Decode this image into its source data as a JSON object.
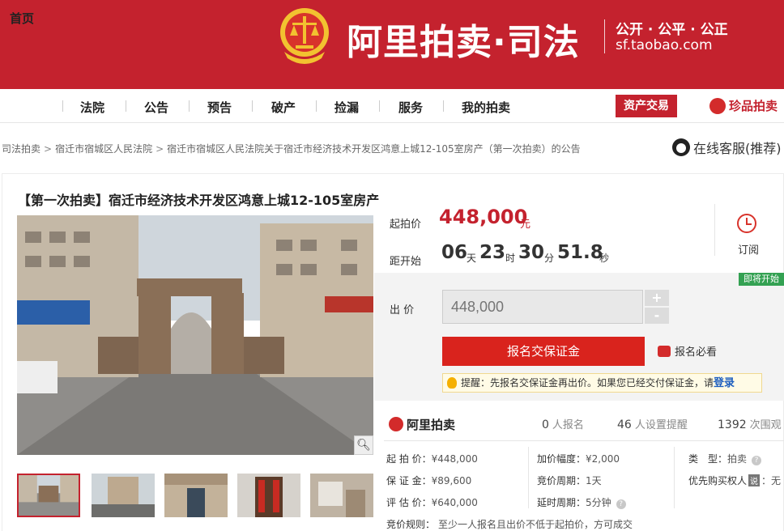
{
  "header": {
    "brand_title": "阿里拍卖·司法",
    "slogan": "公开 · 公平 · 公正",
    "url": "sf.taobao.com"
  },
  "nav": {
    "items": [
      "首页",
      "法院",
      "公告",
      "预告",
      "破产",
      "捡漏",
      "服务",
      "我的拍卖"
    ],
    "assets": "资产交易",
    "zhenpin": "珍品拍卖"
  },
  "breadcrumb": [
    "司法拍卖",
    "宿迁市宿城区人民法院",
    "宿迁市宿城区人民法院关于宿迁市经济技术开发区鸿意上城12-105室房产（第一次拍卖）的公告"
  ],
  "service": "在线客服(推荐)",
  "item": {
    "title": "【第一次拍卖】宿迁市经济技术开发区鸿意上城12-105室房产",
    "start_price_label": "起拍价",
    "start_price": "448,000",
    "currency": "元",
    "countdown_label": "距开始",
    "countdown": {
      "days": "06",
      "days_unit": "天",
      "hours": "23",
      "hours_unit": "时",
      "minutes": "30",
      "minutes_unit": "分",
      "seconds": "51.8",
      "seconds_unit": "秒"
    },
    "subscribe": "订阅",
    "status_badge": "即将开始",
    "bid_label": "出 价",
    "bid_placeholder": "448,000",
    "plus": "+",
    "minus": "-",
    "deposit_button": "报名交保证金",
    "must_see": "报名必看",
    "tip_prefix": "提醒：先报名交保证金再出价。如果您已经交付保证金，请",
    "tip_login": "登录",
    "zoom_icon": "magnifier-icon"
  },
  "stats": {
    "brand": "阿里拍卖",
    "signups": "0",
    "signups_label": "人报名",
    "reminders": "46",
    "reminders_label": "人设置提醒",
    "views": "1392",
    "views_label": "次围观"
  },
  "info": {
    "start_price": {
      "k": "起 拍 价：",
      "v": "¥448,000"
    },
    "deposit": {
      "k": "保 证 金：",
      "v": "¥89,600"
    },
    "appraisal": {
      "k": "评 估 价：",
      "v": "¥640,000"
    },
    "increment": {
      "k": "加价幅度：",
      "v": "¥2,000"
    },
    "period": {
      "k": "竞价周期：",
      "v": "1天"
    },
    "extension": {
      "k": "延时周期：",
      "v": "5分钟"
    },
    "type": {
      "k": "类　型：",
      "v": "拍卖"
    },
    "priority": {
      "k": "优先购买权人",
      "badge": "说",
      "v": "：无"
    },
    "rule": {
      "k": "竞价规则：",
      "v": "至少一人报名且出价不低于起拍价，方可成交"
    }
  },
  "colors": {
    "brand_red": "#c4222e",
    "price_red": "#c4222e",
    "badge_green": "#33a152"
  }
}
